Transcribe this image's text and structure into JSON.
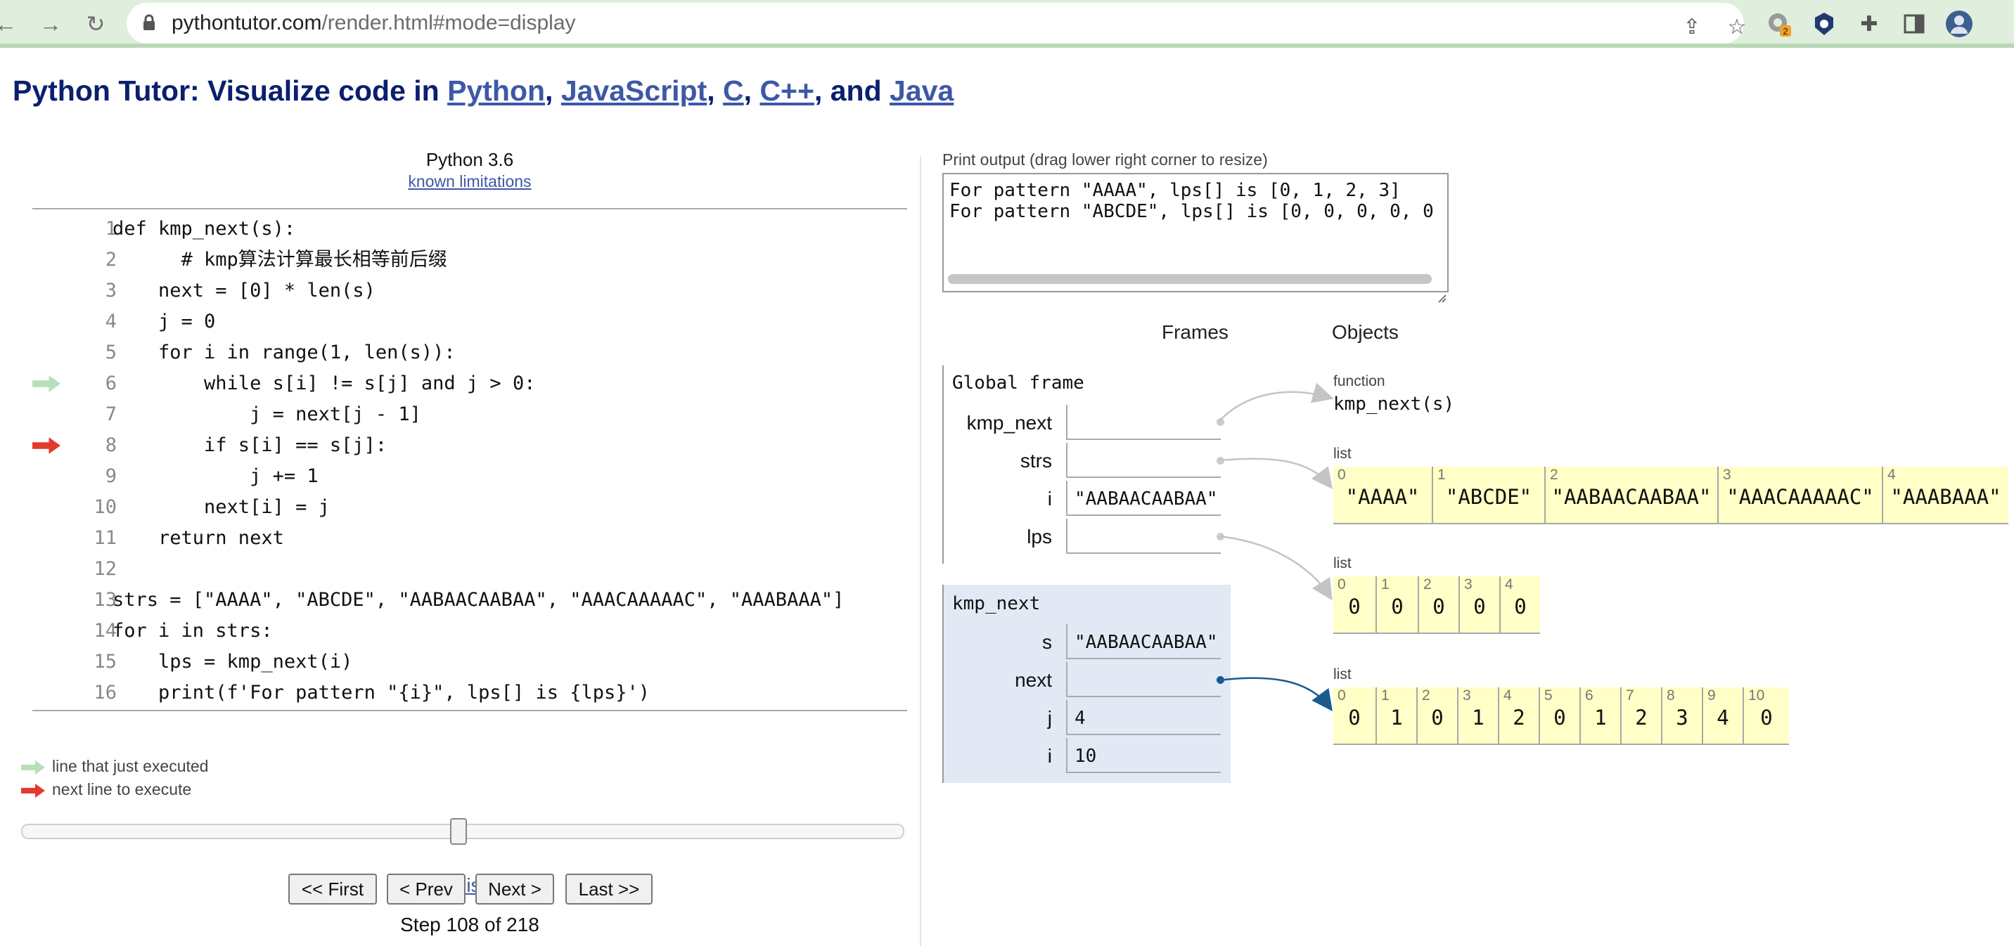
{
  "browser": {
    "url_host": "pythontutor.com",
    "url_path": "/render.html#mode=display",
    "badge_count": "2"
  },
  "title": {
    "prefix": "Python Tutor: Visualize code in ",
    "lang1": "Python",
    "sep1": ", ",
    "lang2": "JavaScript",
    "sep2": ", ",
    "lang3": "C",
    "sep3": ", ",
    "lang4": "C++",
    "sep4": ", and ",
    "lang5": "Java"
  },
  "code_panel": {
    "language": "Python 3.6",
    "limitations_link": "known limitations",
    "lines": [
      {
        "num": "1",
        "code": "def kmp_next(s):"
      },
      {
        "num": "2",
        "code": "      # kmp算法计算最长相等前后缀"
      },
      {
        "num": "3",
        "code": "    next = [0] * len(s)"
      },
      {
        "num": "4",
        "code": "    j = 0"
      },
      {
        "num": "5",
        "code": "    for i in range(1, len(s)):"
      },
      {
        "num": "6",
        "code": "        while s[i] != s[j] and j > 0:"
      },
      {
        "num": "7",
        "code": "            j = next[j - 1]"
      },
      {
        "num": "8",
        "code": "        if s[i] == s[j]:"
      },
      {
        "num": "9",
        "code": "            j += 1"
      },
      {
        "num": "10",
        "code": "        next[i] = j"
      },
      {
        "num": "11",
        "code": "    return next"
      },
      {
        "num": "12",
        "code": ""
      },
      {
        "num": "13",
        "code": "strs = [\"AAAA\", \"ABCDE\", \"AABAACAABAA\", \"AAACAAAAAC\", \"AAABAAA\"]"
      },
      {
        "num": "14",
        "code": "for i in strs:"
      },
      {
        "num": "15",
        "code": "    lps = kmp_next(i)"
      },
      {
        "num": "16",
        "code": "    print(f'For pattern \"{i}\", lps[] is {lps}')"
      }
    ],
    "executed_line": "6",
    "next_line": "8",
    "edit_link": "Edit this code",
    "legend_executed": "line that just executed",
    "legend_next": "next line to execute",
    "slider_position": 0.4954,
    "buttons": {
      "first": "<< First",
      "prev": "< Prev",
      "next": "Next >",
      "last": "Last >>"
    },
    "step_text": "Step 108 of 218"
  },
  "print_output": {
    "label": "Print output (drag lower right corner to resize)",
    "lines": [
      "For pattern \"AAAA\", lps[] is [0, 1, 2, 3]",
      "For pattern \"ABCDE\", lps[] is [0, 0, 0, 0, 0"
    ]
  },
  "headers": {
    "frames": "Frames",
    "objects": "Objects"
  },
  "global_frame": {
    "title": "Global frame",
    "vars": [
      {
        "name": "kmp_next",
        "value": ""
      },
      {
        "name": "strs",
        "value": ""
      },
      {
        "name": "i",
        "value": "\"AABAACAABAA\""
      },
      {
        "name": "lps",
        "value": ""
      }
    ]
  },
  "kmp_frame": {
    "title": "kmp_next",
    "vars": [
      {
        "name": "s",
        "value": "\"AABAACAABAA\""
      },
      {
        "name": "next",
        "value": ""
      },
      {
        "name": "j",
        "value": "4"
      },
      {
        "name": "i",
        "value": "10"
      }
    ]
  },
  "objects": {
    "function": {
      "type": "function",
      "name": "kmp_next(s)"
    },
    "strs_list": {
      "type": "list",
      "indices": [
        "0",
        "1",
        "2",
        "3",
        "4"
      ],
      "values": [
        "\"AAAA\"",
        "\"ABCDE\"",
        "\"AABAACAABAA\"",
        "\"AAACAAAAAC\"",
        "\"AAABAAA\""
      ]
    },
    "lps_list": {
      "type": "list",
      "indices": [
        "0",
        "1",
        "2",
        "3",
        "4"
      ],
      "values": [
        "0",
        "0",
        "0",
        "0",
        "0"
      ]
    },
    "next_list": {
      "type": "list",
      "indices": [
        "0",
        "1",
        "2",
        "3",
        "4",
        "5",
        "6",
        "7",
        "8",
        "9",
        "10"
      ],
      "values": [
        "0",
        "1",
        "0",
        "1",
        "2",
        "0",
        "1",
        "2",
        "3",
        "4",
        "0"
      ]
    }
  },
  "colors": {
    "executed_arrow": "#b8dfb8",
    "next_arrow": "#e23b2e",
    "frame_highlight": "#e2e9f4",
    "list_bg": "#ffffc7",
    "pointer_active": "#1a5b8c"
  }
}
